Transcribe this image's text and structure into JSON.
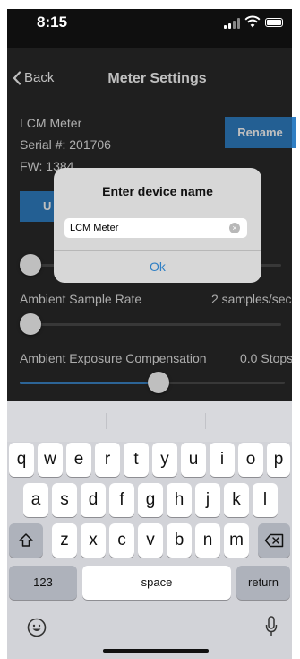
{
  "status_bar": {
    "time": "8:15"
  },
  "nav": {
    "back_label": "Back",
    "title": "Meter Settings"
  },
  "device": {
    "name": "LCM Meter",
    "serial": "Serial #: 201706",
    "firmware": "FW: 1384",
    "rename_label": "Rename",
    "update_label_visible": "U"
  },
  "settings": {
    "ambient_sample_rate": {
      "label": "Ambient Sample Rate",
      "value": "2 samples/sec",
      "slider_fraction": 0.0
    },
    "ambient_exposure_compensation": {
      "label": "Ambient Exposure Compensation",
      "value": "0.0 Stops",
      "slider_fraction": 0.53
    },
    "hidden_slider_fraction": 0.0
  },
  "alert": {
    "title": "Enter device name",
    "input_value": "LCM Meter",
    "ok_label": "Ok"
  },
  "keyboard": {
    "row1": [
      "q",
      "w",
      "e",
      "r",
      "t",
      "y",
      "u",
      "i",
      "o",
      "p"
    ],
    "row2": [
      "a",
      "s",
      "d",
      "f",
      "g",
      "h",
      "j",
      "k",
      "l"
    ],
    "row3": [
      "z",
      "x",
      "c",
      "v",
      "b",
      "n",
      "m"
    ],
    "numbers_label": "123",
    "space_label": "space",
    "return_label": "return"
  },
  "icons": {
    "back": "chevron-left-icon",
    "signal": "cellular-signal-icon",
    "wifi": "wifi-icon",
    "battery": "battery-icon",
    "shift": "shift-arrow-icon",
    "delete": "backspace-icon",
    "emoji": "emoji-icon",
    "mic": "microphone-icon",
    "clear": "clear-text-icon"
  },
  "colors": {
    "accent": "#2f7fc4",
    "background": "#2a2a2a",
    "alert_bg": "#d7d7d7",
    "keyboard_bg": "#d2d3d8"
  }
}
